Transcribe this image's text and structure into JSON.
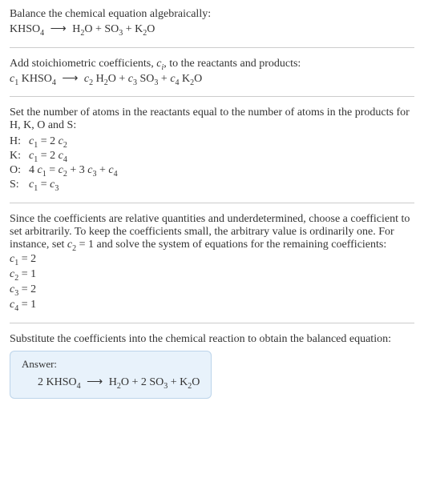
{
  "intro": {
    "line1": "Balance the chemical equation algebraically:",
    "eq1_lhs": "KHSO",
    "eq1_rhs1": "H",
    "eq1_rhs2": "O + SO",
    "eq1_rhs3": " + K",
    "eq1_rhs4": "O"
  },
  "step1": {
    "text_a": "Add stoichiometric coefficients, ",
    "text_b": ", to the reactants and products:",
    "c": "c",
    "i": "i",
    "c1": "c",
    "lhs": " KHSO",
    "rhs_h": " H",
    "rhs_o": "O + ",
    "rhs_so": " SO",
    "rhs_plus": " + ",
    "rhs_k": " K",
    "rhs_ko": "O"
  },
  "step2": {
    "text": "Set the number of atoms in the reactants equal to the number of atoms in the products for H, K, O and S:",
    "rows": {
      "H": {
        "label": "H:",
        "eq_a": "c",
        "eq_b": " = 2 ",
        "eq_c": "c"
      },
      "K": {
        "label": "K:",
        "eq_a": "c",
        "eq_b": " = 2 ",
        "eq_c": "c"
      },
      "O": {
        "label": "O:",
        "eq_a": "4 ",
        "eq_b": "c",
        "eq_c": " = ",
        "eq_d": "c",
        "eq_e": " + 3 ",
        "eq_f": "c",
        "eq_g": " + ",
        "eq_h": "c"
      },
      "S": {
        "label": "S:",
        "eq_a": "c",
        "eq_b": " = ",
        "eq_c": "c"
      }
    }
  },
  "step3": {
    "text_a": "Since the coefficients are relative quantities and underdetermined, choose a coefficient to set arbitrarily. To keep the coefficients small, the arbitrary value is ordinarily one. For instance, set ",
    "text_b": " = 1 and solve the system of equations for the remaining coefficients:",
    "sol": {
      "c1": " = 2",
      "c2": " = 1",
      "c3": " = 2",
      "c4": " = 1"
    }
  },
  "step4": {
    "text": "Substitute the coefficients into the chemical reaction to obtain the balanced equation:"
  },
  "answer": {
    "label": "Answer:",
    "lhs": "2 KHSO",
    "rhs_h": "H",
    "rhs_o": "O + 2 SO",
    "rhs_k": " + K",
    "rhs_ko": "O"
  },
  "nums": {
    "n1": "1",
    "n2": "2",
    "n3": "3",
    "n4": "4"
  }
}
